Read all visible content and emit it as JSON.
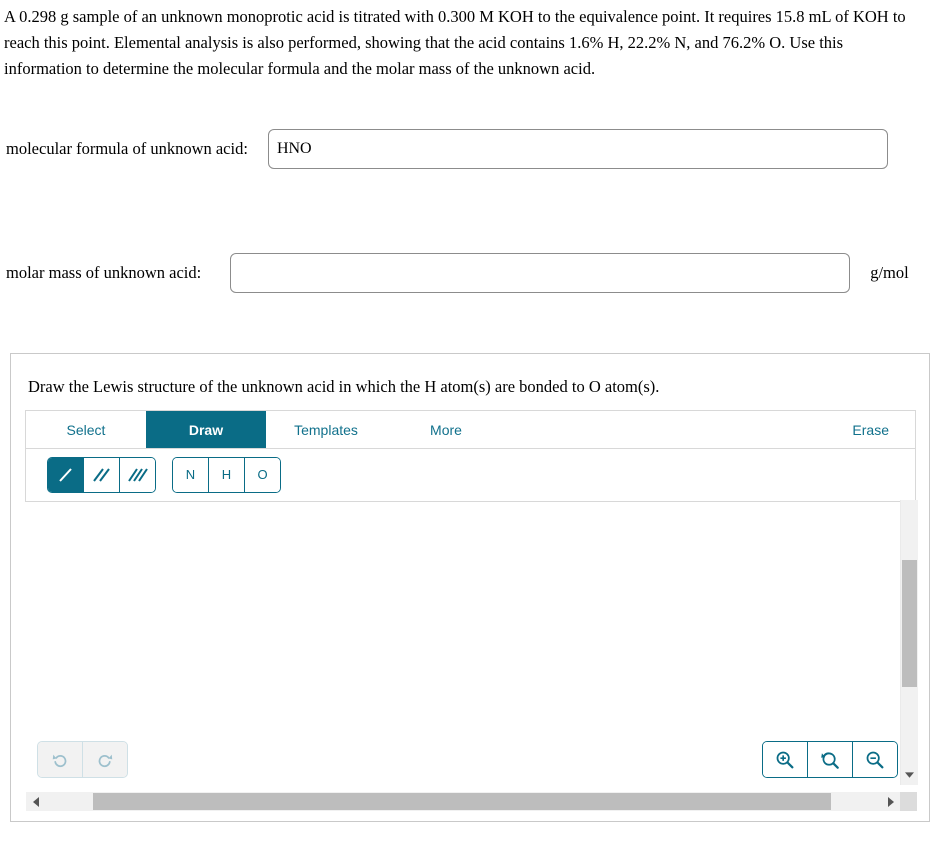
{
  "question": {
    "text": "A 0.298 g sample of an unknown monoprotic acid is titrated with 0.300 M KOH to the equivalence point. It requires 15.8 mL of KOH to reach this point. Elemental analysis is also performed, showing that the acid contains 1.6% H, 22.2% N, and 76.2% O. Use this information to determine the molecular formula and the molar mass of the unknown acid."
  },
  "answers": {
    "formula": {
      "label": "molecular formula of unknown acid:",
      "value": "HNO",
      "placeholder": ""
    },
    "molar_mass": {
      "label": "molar mass of unknown acid:",
      "value": "",
      "placeholder": "",
      "unit": "g/mol"
    }
  },
  "sketcher": {
    "instruction": "Draw the Lewis structure of the unknown acid in which the H atom(s) are bonded to O atom(s).",
    "tabs": [
      {
        "label": "Select",
        "active": false
      },
      {
        "label": "Draw",
        "active": true
      },
      {
        "label": "Templates",
        "active": false
      },
      {
        "label": "More",
        "active": false
      }
    ],
    "erase_label": "Erase",
    "bond_tools": [
      {
        "name": "single-bond",
        "active": true
      },
      {
        "name": "double-bond",
        "active": false
      },
      {
        "name": "triple-bond",
        "active": false
      }
    ],
    "atom_tools": [
      {
        "label": "N"
      },
      {
        "label": "H"
      },
      {
        "label": "O"
      }
    ],
    "history_buttons": [
      {
        "name": "undo-icon",
        "glyph": "↺"
      },
      {
        "name": "redo-icon",
        "glyph": "↻"
      }
    ],
    "zoom_buttons": [
      {
        "name": "zoom-in-icon"
      },
      {
        "name": "zoom-reset-icon"
      },
      {
        "name": "zoom-out-icon"
      }
    ],
    "canvas_content": ""
  },
  "colors": {
    "accent_teal": "#0a6c86",
    "tab_text": "#11718c",
    "border_gray": "#d8d8d8",
    "panel_border": "#c9c9c9",
    "input_border": "#8c8c8c",
    "scroll_thumb": "#bdbdbd",
    "scroll_track": "#f1f1f1",
    "disabled_icon": "#9dc0cd"
  }
}
